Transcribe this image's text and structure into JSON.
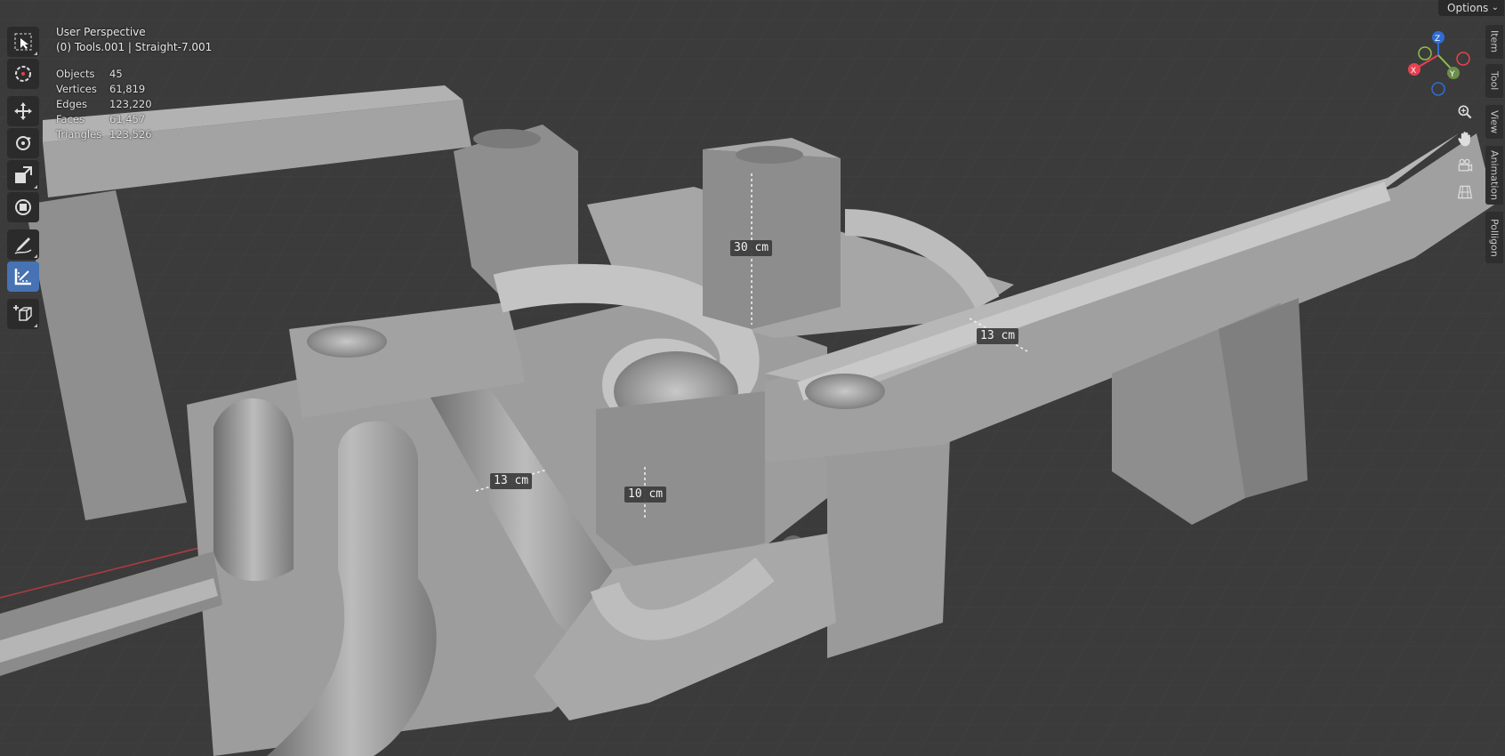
{
  "viewport": {
    "perspective_label": "User Perspective",
    "object_info": "(0) Tools.001 | Straight-7.001",
    "stats": [
      {
        "label": "Objects",
        "value": "45"
      },
      {
        "label": "Vertices",
        "value": "61,819"
      },
      {
        "label": "Edges",
        "value": "123,220"
      },
      {
        "label": "Faces",
        "value": "61,457"
      },
      {
        "label": "Triangles",
        "value": "123,526"
      }
    ],
    "options_label": "Options",
    "gizmo": {
      "x": "X",
      "y": "Y",
      "z": "Z"
    },
    "measurements": [
      "30 cm",
      "13 cm",
      "13 cm",
      "10 cm"
    ]
  },
  "toolbar": {
    "tools": [
      {
        "name": "select-box-tool",
        "icon": "select-box-icon"
      },
      {
        "name": "cursor-tool",
        "icon": "cursor-icon"
      },
      {
        "name": "move-tool",
        "icon": "move-icon"
      },
      {
        "name": "rotate-tool",
        "icon": "rotate-icon"
      },
      {
        "name": "scale-tool",
        "icon": "scale-icon"
      },
      {
        "name": "transform-tool",
        "icon": "transform-icon"
      },
      {
        "name": "annotate-tool",
        "icon": "annotate-icon"
      },
      {
        "name": "measure-tool",
        "icon": "measure-icon",
        "active": true
      },
      {
        "name": "add-cube-tool",
        "icon": "add-cube-icon"
      }
    ]
  },
  "sidebar_tabs": [
    "Item",
    "Tool",
    "View",
    "Animation",
    "Polligon"
  ],
  "navigation": [
    "zoom-icon",
    "pan-hand-icon",
    "camera-icon",
    "grid-view-icon"
  ],
  "colors": {
    "background": "#3a3a3a",
    "active_tool": "#4772b3",
    "axis_x": "#e8414e",
    "axis_y": "#8bc34a",
    "axis_z": "#2f6dd5",
    "model": "#9a9a9a"
  }
}
